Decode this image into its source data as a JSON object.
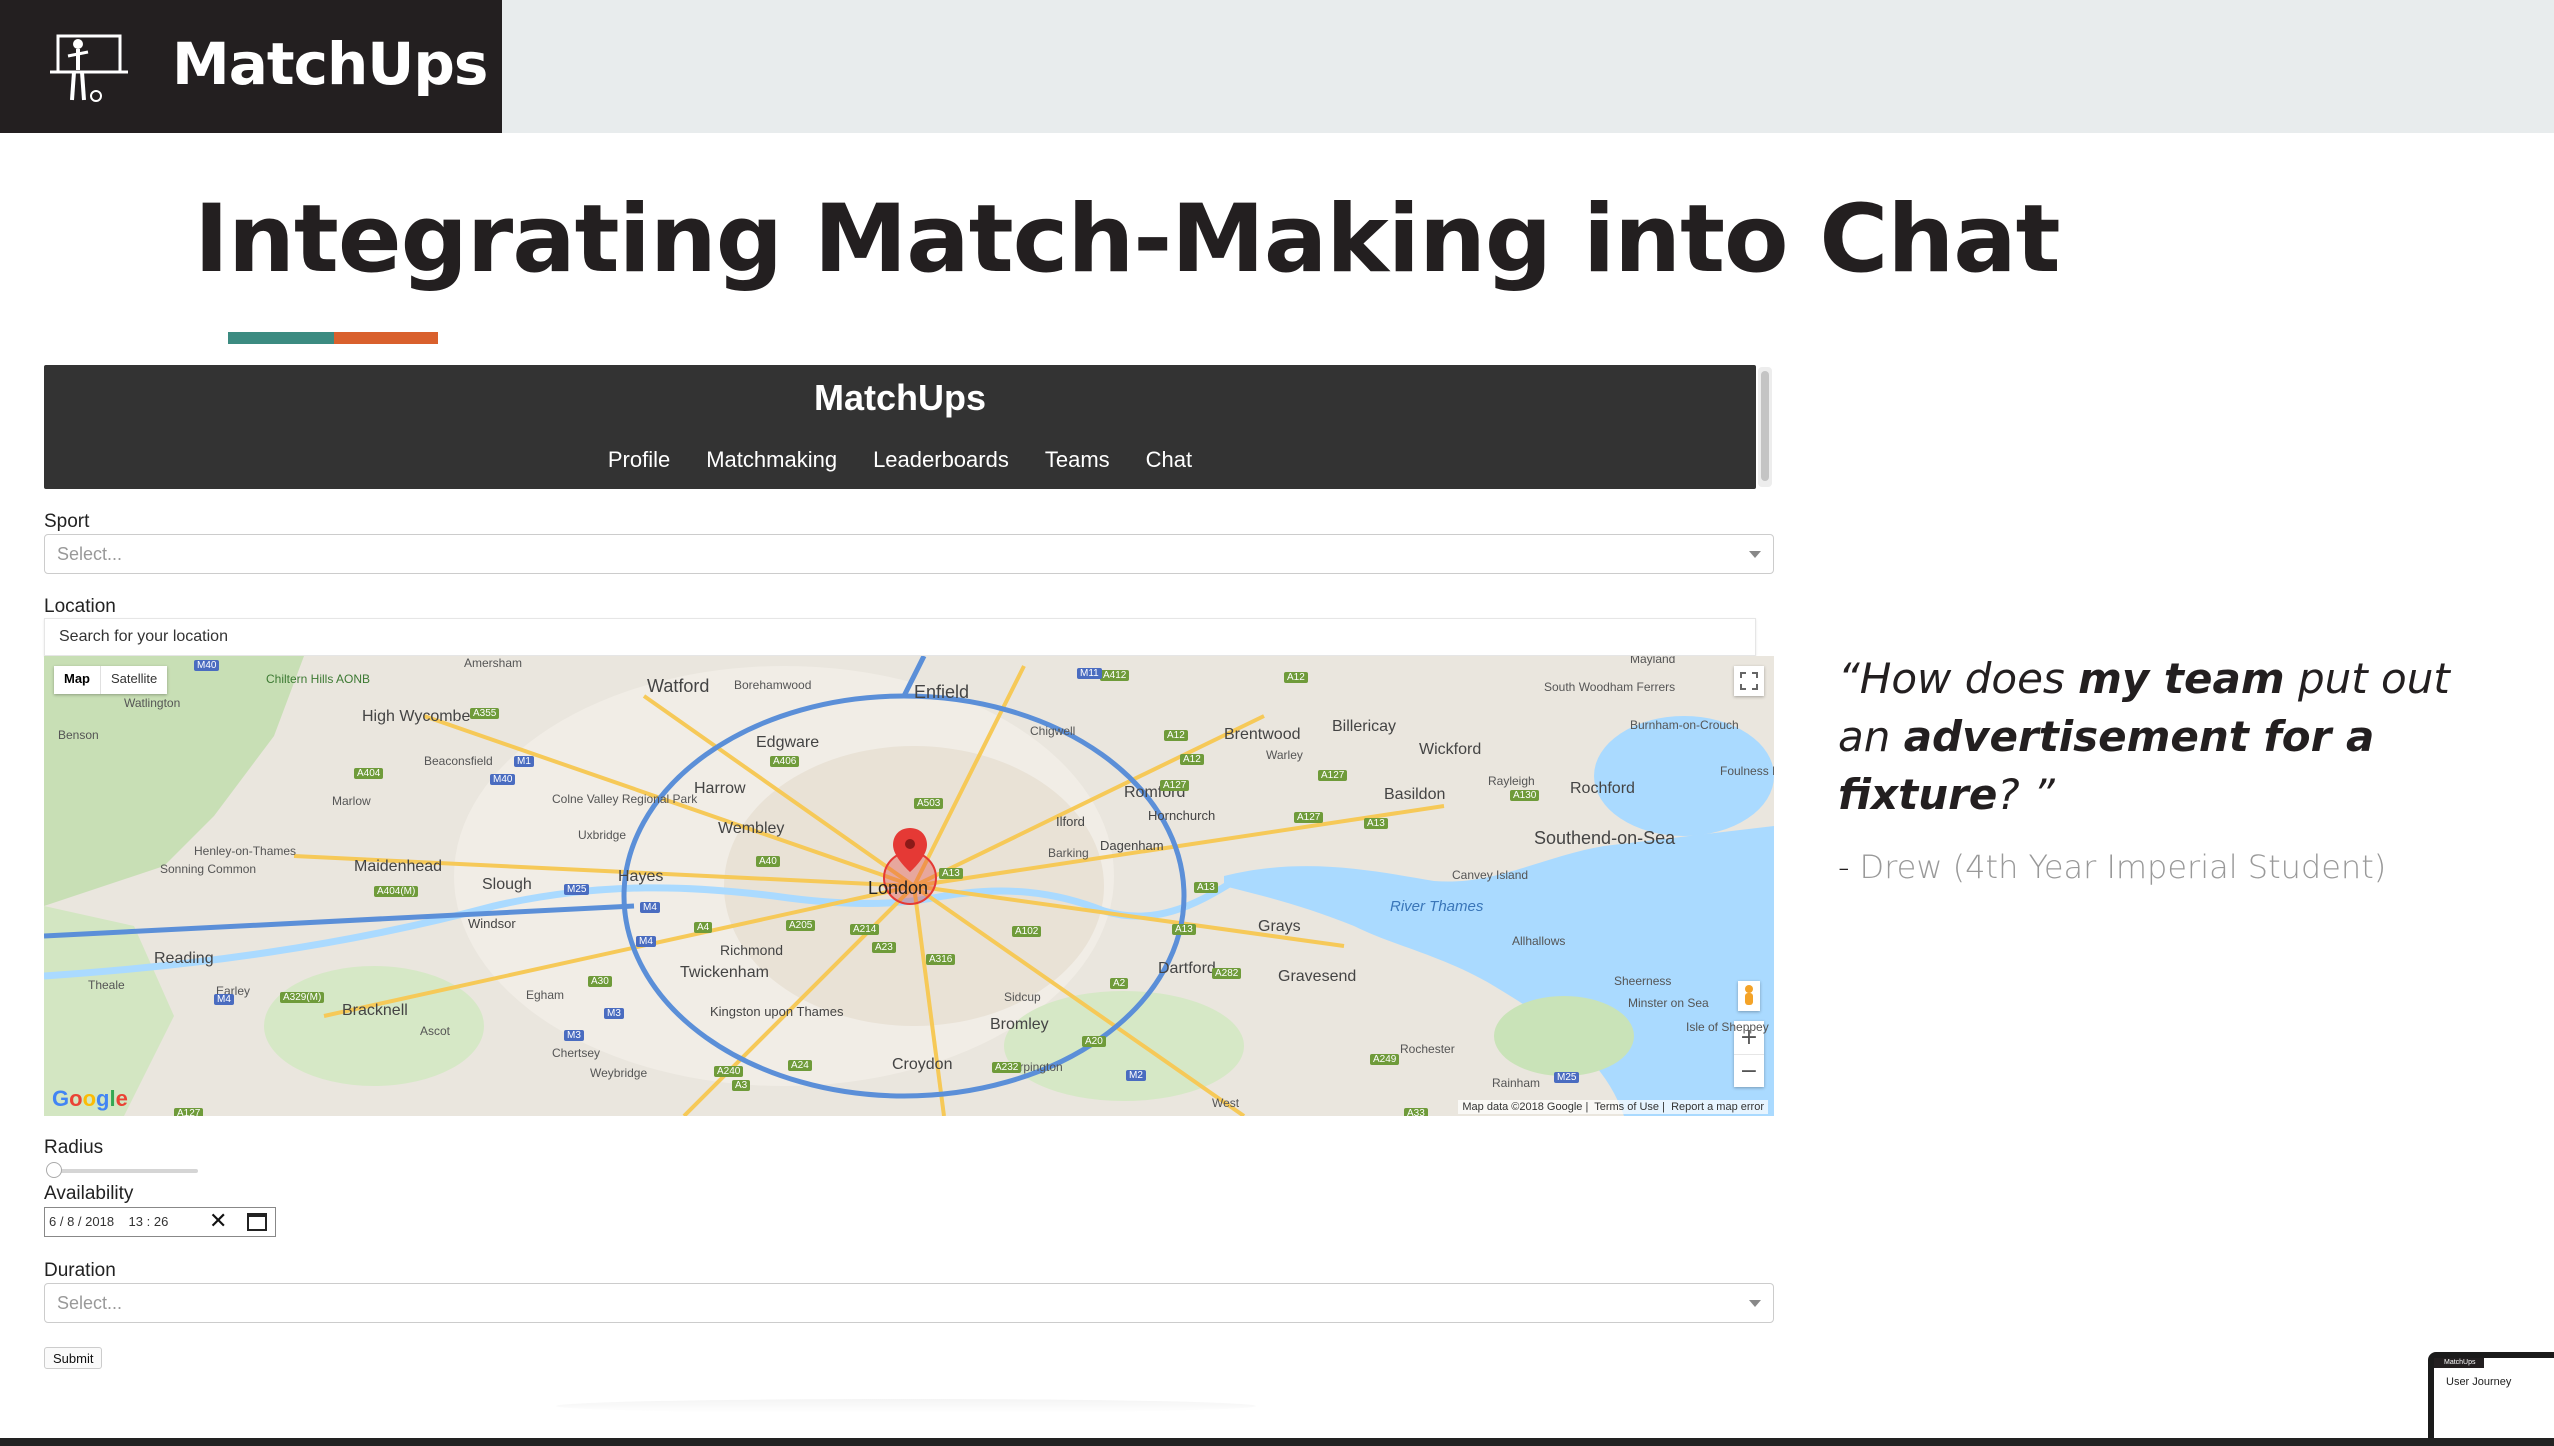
{
  "brand": {
    "name": "MatchUps"
  },
  "slide": {
    "title": "Integrating Match-Making into Chat"
  },
  "app": {
    "nav_title": "MatchUps",
    "nav_links": [
      "Profile",
      "Matchmaking",
      "Leaderboards",
      "Teams",
      "Chat"
    ],
    "sport_label": "Sport",
    "sport_placeholder": "Select...",
    "location_label": "Location",
    "location_placeholder": "Search for your location",
    "map": {
      "type_buttons": [
        "Map",
        "Satellite"
      ],
      "places": [
        "Watford",
        "Enfield",
        "High Wycombe",
        "Edgware",
        "Harrow",
        "Brentwood",
        "Billericay",
        "Wickford",
        "Basildon",
        "Rochford",
        "Southend-on-Sea",
        "Romford",
        "Ilford",
        "Dagenham",
        "Hornchurch",
        "Wembley",
        "Hayes",
        "Slough",
        "Maidenhead",
        "London",
        "Windsor",
        "Richmond",
        "Twickenham",
        "Reading",
        "Bracknell",
        "Kingston upon Thames",
        "Croydon",
        "Bromley",
        "Dartford",
        "Gravesend",
        "Grays",
        "Sidcup",
        "Canvey Island",
        "Rayleigh",
        "Amersham",
        "Beaconsfield",
        "Marlow",
        "Henley-on-Thames",
        "Egham",
        "Ascot",
        "Chertsey",
        "Weybridge",
        "Orpington",
        "Rochester",
        "Rainham",
        "Sheerness",
        "Allhallows",
        "Chigwell",
        "Borehamwood",
        "Uxbridge",
        "Chiltern Hills AONB",
        "River Thames",
        "Mayland",
        "South Woodham Ferrers",
        "Foulness Island",
        "Burnham-on-Crouch",
        "Minster on Sea",
        "Isle of Sheppey",
        "Sonning Common",
        "Earley",
        "Theale",
        "Benson",
        "Watlington",
        "Colne Valley Regional Park",
        "Barking",
        "Warley",
        "West"
      ],
      "road_badges": [
        "M40",
        "A355",
        "A404",
        "M40",
        "A412",
        "M1",
        "A406",
        "A503",
        "M11",
        "A12",
        "A127",
        "A130",
        "A12",
        "A12",
        "A127",
        "A127",
        "A13",
        "A13",
        "A40",
        "M25",
        "M4",
        "A404(M)",
        "M4",
        "A4",
        "A205",
        "A13",
        "A102",
        "A13",
        "A282",
        "A214",
        "A23",
        "A316",
        "A30",
        "M4",
        "A329(M)",
        "M3",
        "M3",
        "A240",
        "A24",
        "A3",
        "A232",
        "A20",
        "A2",
        "A249",
        "M25",
        "M2",
        "A33",
        "A127"
      ],
      "attribution": "Map data ©2018 Google",
      "terms": "Terms of Use",
      "report": "Report a map error",
      "logo": "Google"
    },
    "radius_label": "Radius",
    "radius_value": 0,
    "availability_label": "Availability",
    "availability_day": "6",
    "availability_month": "8",
    "availability_year": "2018",
    "availability_hour": "13",
    "availability_minute": "26",
    "duration_label": "Duration",
    "duration_placeholder": "Select...",
    "submit_label": "Submit"
  },
  "quote": {
    "open": "“How does ",
    "bold1": "my team",
    "mid": " put out an ",
    "bold2": "advertisement for a fixture",
    "close": "? ”",
    "dash": "-",
    "author": "Drew  (4th Year Imperial Student)"
  },
  "thumbnail": {
    "brand": "MatchUps",
    "title": "User Journey"
  },
  "colors": {
    "brand_dark": "#231f20",
    "accent_teal": "#3c8b81",
    "accent_orange": "#d9602d",
    "app_nav": "#333333",
    "map_water": "#aadaff",
    "map_land": "#e8e4dc",
    "pin_red": "#e53935"
  }
}
